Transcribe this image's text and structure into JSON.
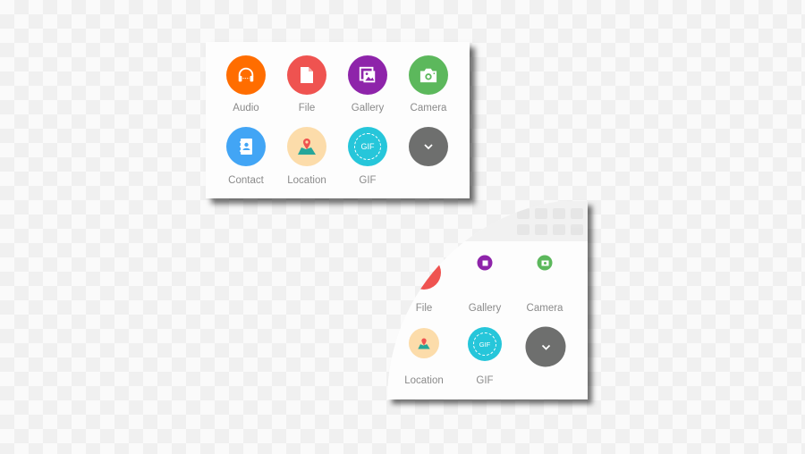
{
  "attach_menu": {
    "items": [
      {
        "label": "Audio",
        "icon": "headphones-icon",
        "color": "#ff6d00"
      },
      {
        "label": "File",
        "icon": "file-icon",
        "color": "#ef5350"
      },
      {
        "label": "Gallery",
        "icon": "gallery-icon",
        "color": "#8e24aa"
      },
      {
        "label": "Camera",
        "icon": "camera-icon",
        "color": "#5cb85c"
      },
      {
        "label": "Contact",
        "icon": "contact-icon",
        "color": "#42a5f5"
      },
      {
        "label": "Location",
        "icon": "map-pin-icon",
        "color": "#fcdcaa"
      },
      {
        "label": "GIF",
        "icon": "gif-icon",
        "color": "#26c6da",
        "icon_text": "GIF"
      },
      {
        "label": "",
        "icon": "chevron-down-icon",
        "color": "#6e6f6e"
      }
    ]
  },
  "reveal_menu": {
    "items": [
      {
        "label": "File"
      },
      {
        "label": "Gallery"
      },
      {
        "label": "Camera"
      },
      {
        "label": "Location"
      },
      {
        "label": "GIF",
        "icon_text": "GIF"
      }
    ]
  }
}
